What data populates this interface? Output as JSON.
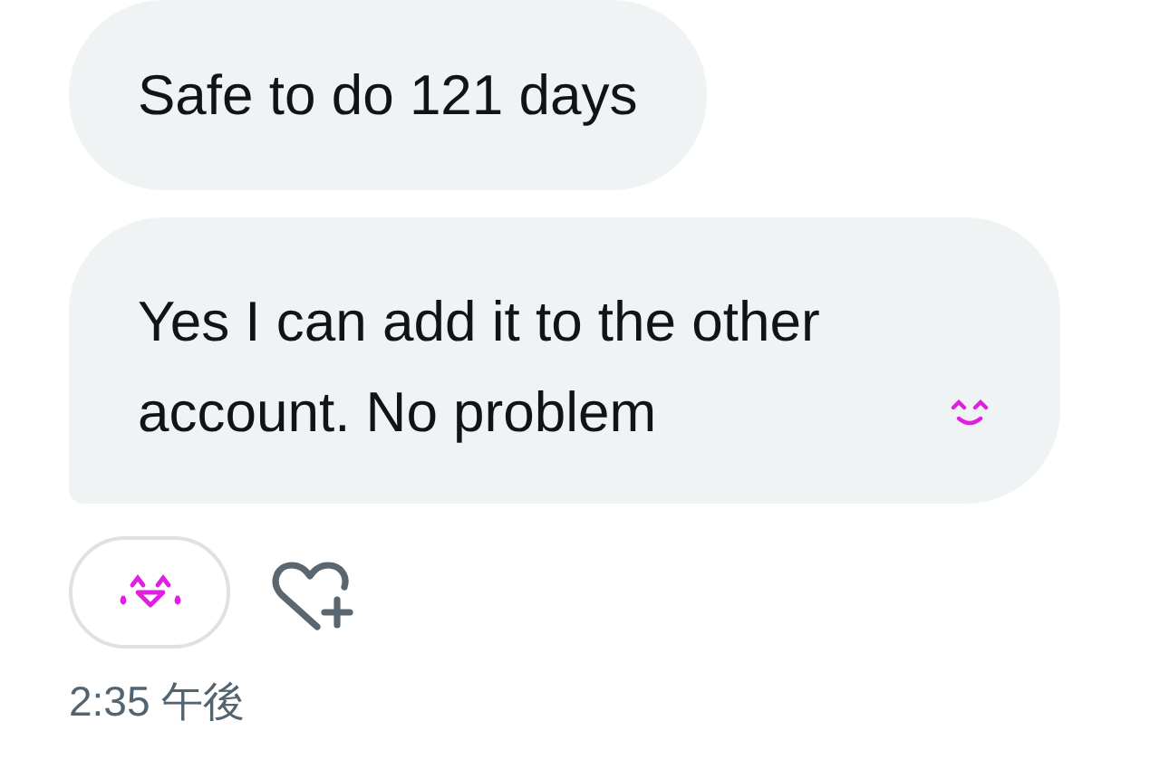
{
  "messages": [
    {
      "text": "Safe to do 121 days",
      "emoji": false
    },
    {
      "text": "Yes I can add it to the other account. No problem",
      "emoji": true
    }
  ],
  "reaction": {
    "kind": "laugh"
  },
  "timestamp": "2:35 午後"
}
